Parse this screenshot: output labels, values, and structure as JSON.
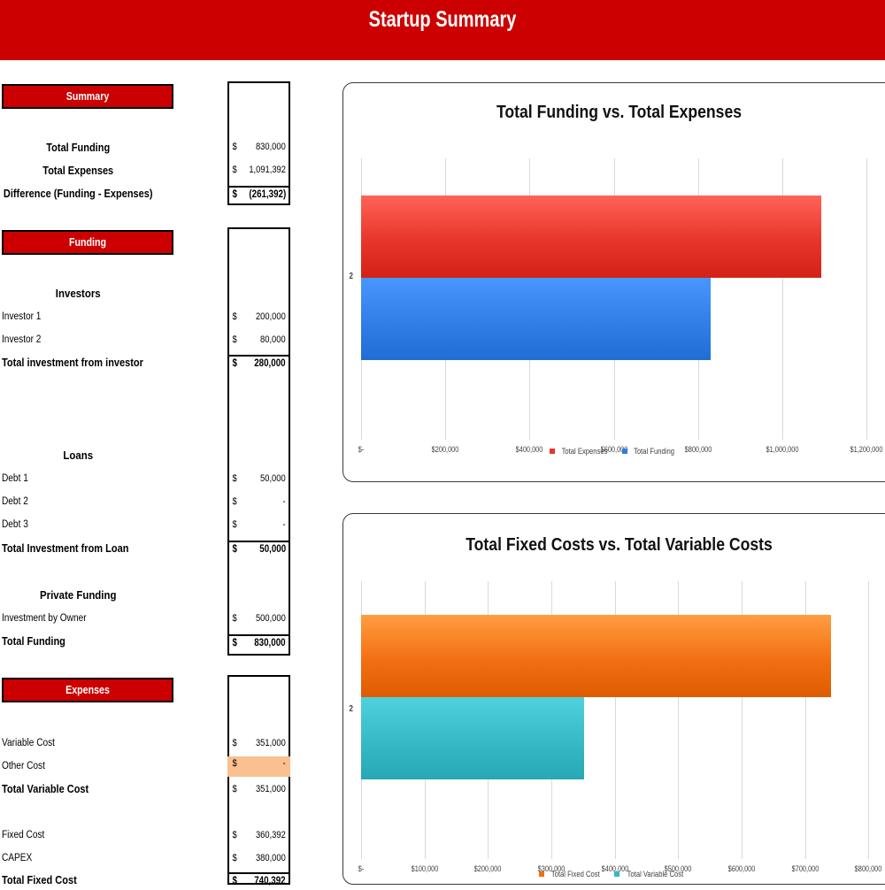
{
  "header": {
    "title": "Startup Summary",
    "bg": "#CC0000"
  },
  "sections": {
    "summary": {
      "heading": "Summary",
      "rows": [
        {
          "label": "Total Funding",
          "currency": "$",
          "value": "830,000"
        },
        {
          "label": "Total Expenses",
          "currency": "$",
          "value": "1,091,392"
        },
        {
          "label": "Difference (Funding - Expenses)",
          "currency": "$",
          "value": "(261,392)"
        }
      ]
    },
    "funding": {
      "heading": "Funding",
      "investors_heading": "Investors",
      "investor_rows": [
        {
          "label": "Investor 1",
          "currency": "$",
          "value": "200,000"
        },
        {
          "label": "Investor 2",
          "currency": "$",
          "value": "80,000"
        },
        {
          "label": "Total investment from investor",
          "currency": "$",
          "value": "280,000"
        }
      ],
      "loans_heading": "Loans",
      "loan_rows": [
        {
          "label": "Debt 1",
          "currency": "$",
          "value": "50,000"
        },
        {
          "label": "Debt 2",
          "currency": "$",
          "value": "-"
        },
        {
          "label": "Debt 3",
          "currency": "$",
          "value": "-"
        },
        {
          "label": "Total Investment from Loan",
          "currency": "$",
          "value": "50,000"
        }
      ],
      "private_heading": "Private Funding",
      "private_rows": [
        {
          "label": "Investment by Owner",
          "currency": "$",
          "value": "500,000"
        },
        {
          "label": "Total Funding",
          "currency": "$",
          "value": "830,000"
        }
      ]
    },
    "expenses": {
      "heading": "Expenses",
      "variable_rows": [
        {
          "label": "Variable Cost",
          "currency": "$",
          "value": "351,000"
        },
        {
          "label": "Other Cost",
          "currency": "$",
          "value": "-"
        },
        {
          "label": "Total Variable Cost",
          "currency": "$",
          "value": "351,000"
        }
      ],
      "fixed_rows": [
        {
          "label": "Fixed Cost",
          "currency": "$",
          "value": "360,392"
        },
        {
          "label": "CAPEX",
          "currency": "$",
          "value": "380,000"
        },
        {
          "label": "Total Fixed Cost",
          "currency": "$",
          "value": "740,392"
        }
      ],
      "highlight_color": "#FAC090"
    }
  },
  "chart_data": [
    {
      "type": "bar",
      "orientation": "horizontal",
      "title": "Total Funding vs. Total Expenses",
      "categories": [
        "2"
      ],
      "series": [
        {
          "name": "Total Expenses",
          "values": [
            1091392
          ],
          "color": "#E8352B"
        },
        {
          "name": "Total Funding",
          "values": [
            830000
          ],
          "color": "#2E7CE4"
        }
      ],
      "xlabel": "",
      "ylabel": "",
      "xlim": [
        0,
        1250000
      ],
      "xticks": [
        0,
        200000,
        400000,
        600000,
        800000,
        1000000,
        1200000
      ],
      "xticklabels": [
        "$-",
        "$200,000",
        "$400,000",
        "$600,000",
        "$800,000",
        "$1,000,000",
        "$1,200,000"
      ],
      "grid": true,
      "legend_position": "bottom"
    },
    {
      "type": "bar",
      "orientation": "horizontal",
      "title": "Total Fixed Costs vs. Total Variable Costs",
      "categories": [
        "2"
      ],
      "series": [
        {
          "name": "Total Fixed Cost",
          "values": [
            740392
          ],
          "color": "#F36F13"
        },
        {
          "name": "Total Variable Cost",
          "values": [
            351000
          ],
          "color": "#35B7C4"
        }
      ],
      "xlabel": "",
      "ylabel": "",
      "xlim": [
        0,
        830000
      ],
      "xticks": [
        0,
        100000,
        200000,
        300000,
        400000,
        500000,
        600000,
        700000,
        800000
      ],
      "xticklabels": [
        "$-",
        "$100,000",
        "$200,000",
        "$300,000",
        "$400,000",
        "$500,000",
        "$600,000",
        "$700,000",
        "$800,000"
      ],
      "grid": true,
      "legend_position": "bottom"
    }
  ]
}
